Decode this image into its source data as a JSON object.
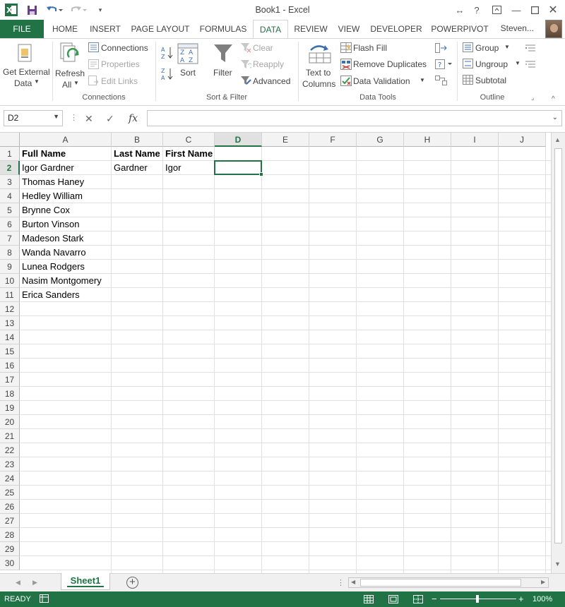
{
  "window": {
    "title": "Book1 - Excel",
    "user": "Steven..."
  },
  "tabs": [
    "FILE",
    "HOME",
    "INSERT",
    "PAGE LAYOUT",
    "FORMULAS",
    "DATA",
    "REVIEW",
    "VIEW",
    "DEVELOPER",
    "POWERPIVOT"
  ],
  "active_tab": "DATA",
  "ribbon": {
    "get_external_data_1": "Get External",
    "get_external_data_2": "Data",
    "refresh_all_1": "Refresh",
    "refresh_all_2": "All",
    "connections": "Connections",
    "properties": "Properties",
    "edit_links": "Edit Links",
    "group_connections": "Connections",
    "sort": "Sort",
    "filter": "Filter",
    "clear": "Clear",
    "reapply": "Reapply",
    "advanced": "Advanced",
    "group_sort_filter": "Sort & Filter",
    "text_to_columns_1": "Text to",
    "text_to_columns_2": "Columns",
    "flash_fill": "Flash Fill",
    "remove_duplicates": "Remove Duplicates",
    "data_validation": "Data Validation",
    "group_data_tools": "Data Tools",
    "group": "Group",
    "ungroup": "Ungroup",
    "subtotal": "Subtotal",
    "group_outline": "Outline"
  },
  "formula_bar": {
    "name_box": "D2",
    "formula": ""
  },
  "columns": [
    "A",
    "B",
    "C",
    "D",
    "E",
    "F",
    "G",
    "H",
    "I",
    "J"
  ],
  "selected_column": "D",
  "selected_row": 2,
  "rows": 30,
  "cells": {
    "A1": "Full Name",
    "B1": "Last Name",
    "C1": "First Name",
    "A2": "Igor Gardner",
    "B2": "Gardner",
    "C2": "Igor",
    "A3": "Thomas Haney",
    "A4": "Hedley William",
    "A5": "Brynne Cox",
    "A6": "Burton Vinson",
    "A7": "Madeson Stark",
    "A8": "Wanda Navarro",
    "A9": "Lunea Rodgers",
    "A10": "Nasim Montgomery",
    "A11": "Erica Sanders"
  },
  "sheets": [
    "Sheet1"
  ],
  "status": {
    "state": "READY",
    "zoom": "100%"
  }
}
